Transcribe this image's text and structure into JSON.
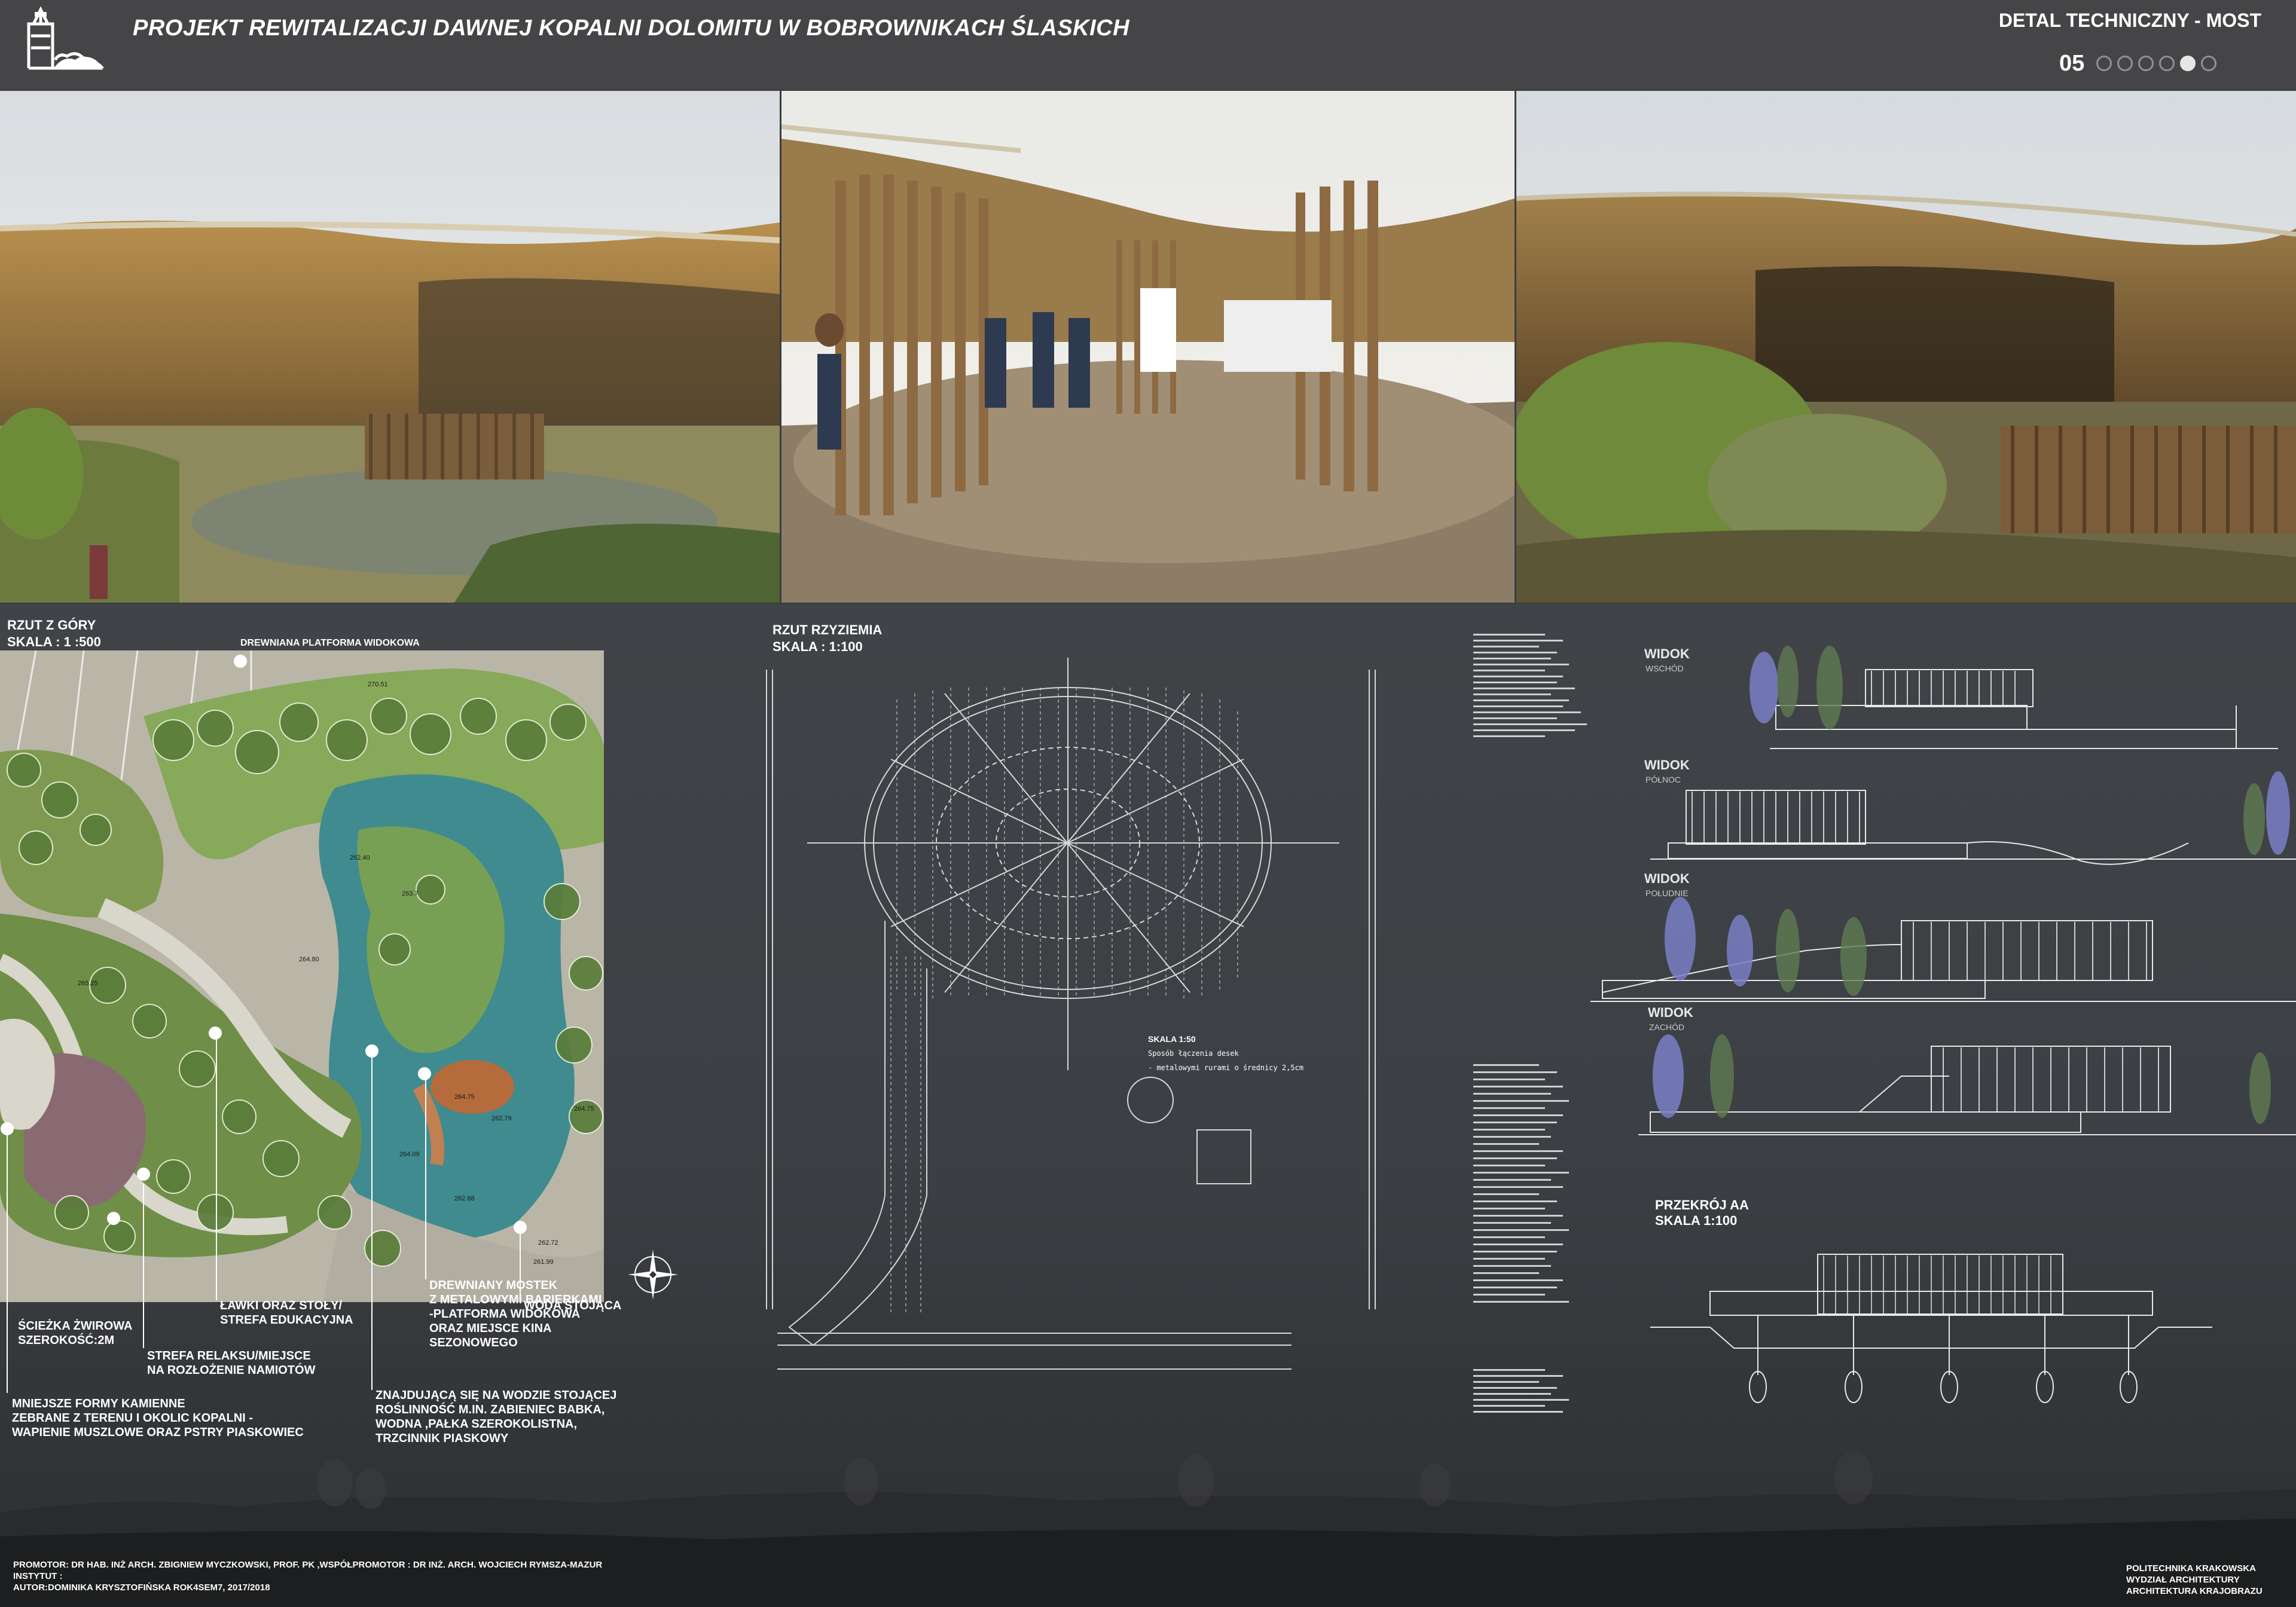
{
  "header": {
    "title": "PROJEKT REWITALIZACJI  DAWNEJ KOPALNI DOLOMITU W BOBROWNIKACH ŚLASKICH",
    "section_title": "DETAL TECHNICZNY - MOST",
    "page_number": "05",
    "page_count": 6,
    "active_page": 5
  },
  "plan": {
    "title": "RZUT Z GÓRY",
    "scale": "SKALA : 1 :500",
    "callouts": {
      "platform": "DREWNIANA PLATFORMA WIDOKOWA",
      "path": "ŚCIEŻKA ŻWIROWA\nSZEROKOŚĆ:2M",
      "relax": "STREFA RELAKSU/MIEJSCE\nNA ROZŁOŻENIE NAMIOTÓW",
      "benches": "ŁAWKI ORAZ STOŁY/\nSTREFA EDUKACYJNA",
      "stones": "MNIEJSZE FORMY KAMIENNE\n ZEBRANE Z TERENU I OKOLIC KOPALNI -\nWAPIENIE MUSZLOWE ORAZ PSTRY PIASKOWIEC",
      "vegetation": "ZNAJDUJĄCĄ SIĘ NA WODZIE STOJĄCEJ\nROŚLINNOŚĆ M.IN. ZABIENIEC BABKA,\nWODNA ,PAŁKA SZEROKOLISTNA,\nTRZCINNIK PIASKOWY",
      "bridge": "DREWNIANY MOSTEK\nZ METALOWYMI BARIERKAMI\n-PLATFORMA WIDOKOWA\nORAZ MIEJSCE KINA\nSEZONOWEGO",
      "water": "WODA STOJĄCA"
    },
    "elevations": [
      "270.51",
      "262.40",
      "263.7",
      "264.80",
      "264.75",
      "262.79",
      "264.75",
      "262.72",
      "261.99",
      "265.25",
      "264.09",
      "262.88"
    ]
  },
  "ground_plan": {
    "title": "RZUt RZYZIEMIA",
    "scale": "SKALA : 1:100",
    "detail_scale": "SKALA 1:50",
    "detail_note": "Sposób łączenia desek\n- metalowymi rurami o średnicy 2,5cm"
  },
  "views": [
    {
      "title": "WIDOK",
      "sub": "WSCHÓD"
    },
    {
      "title": "WIDOK",
      "sub": "PÓŁNOC"
    },
    {
      "title": "WIDOK",
      "sub": "POŁUDNIE"
    },
    {
      "title": "WIDOK",
      "sub": "ZACHÓD"
    }
  ],
  "section": {
    "title": "PRZEKRÓJ AA",
    "scale": "SKALA 1:100"
  },
  "footer": {
    "credits": "PROMOTOR: DR HAB. INŻ ARCH. ZBIGNIEW MYCZKOWSKI, PROF. PK ,WSPÓŁPROMOTOR : DR INŻ. ARCH. WOJCIECH RYMSZA-MAZUR\nINSTYTUT :\nAUTOR:DOMINIKA KRYSZTOFIŃSKA ROK4SEM7, 2017/2018",
    "institution": "POLITECHNIKA KRAKOWSKA\nWYDZIAŁ ARCHITEKTURY\nARCHITEKTURA KRAJOBRAZU"
  },
  "colors": {
    "header_bg": "#454547",
    "board_bg": "#3c3f43",
    "text": "#ffffff",
    "water": "#3f8b8f",
    "vegetation": "#7ea85a"
  }
}
